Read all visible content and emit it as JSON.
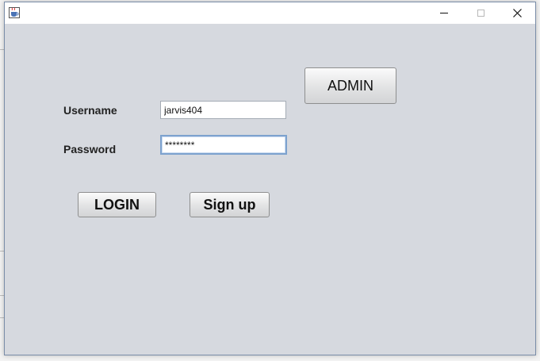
{
  "window": {
    "icon": "java-coffee-cup-icon",
    "controls": {
      "minimize": "minimize-icon",
      "maximize": "maximize-icon",
      "close": "close-icon"
    }
  },
  "form": {
    "username_label": "Username",
    "username_value": "jarvis404",
    "password_label": "Password",
    "password_value": "********",
    "admin_button": "ADMIN",
    "login_button": "LOGIN",
    "signup_button": "Sign up"
  }
}
